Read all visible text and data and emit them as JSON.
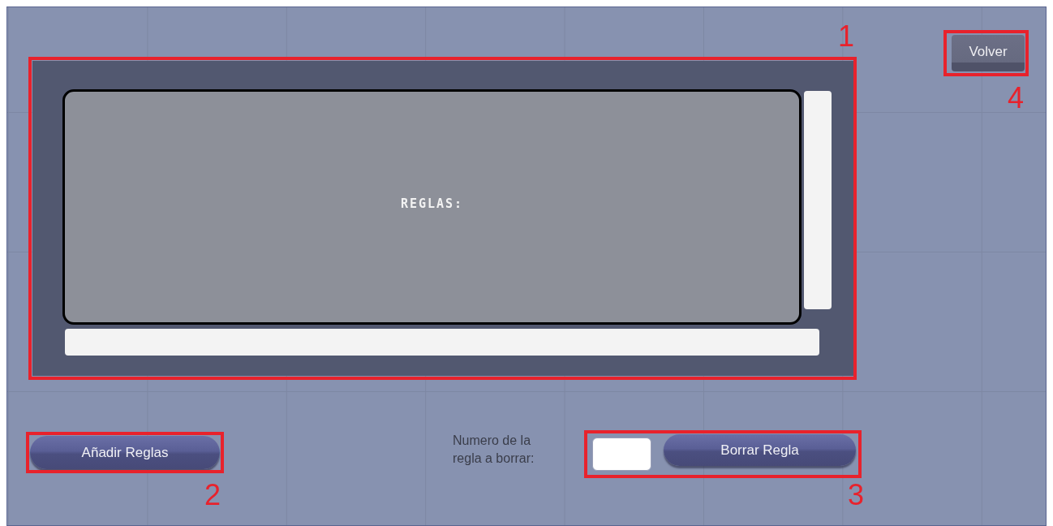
{
  "rules_panel": {
    "heading": "REGLAS:"
  },
  "back_button": {
    "label": "Volver"
  },
  "add_button": {
    "label": "Añadir Reglas"
  },
  "delete_rule": {
    "label": "Numero de la regla a borrar:",
    "button": "Borrar Regla"
  },
  "callouts": [
    {
      "number": "1"
    },
    {
      "number": "2"
    },
    {
      "number": "3"
    },
    {
      "number": "4"
    }
  ]
}
